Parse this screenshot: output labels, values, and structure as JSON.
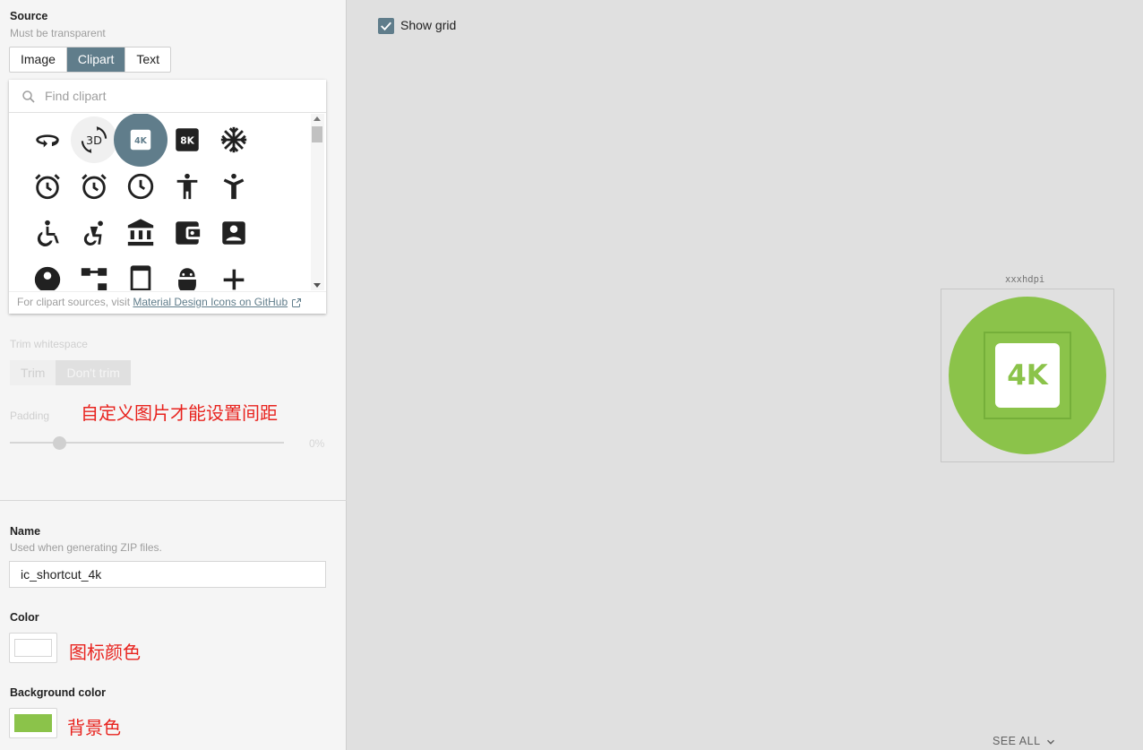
{
  "colors": {
    "accent": "#607d8b",
    "icon_color": "#ffffff",
    "background_color": "#8bc34a",
    "annotation_red": "#e8231e"
  },
  "source": {
    "label": "Source",
    "hint": "Must be transparent",
    "options": [
      "Image",
      "Clipart",
      "Text"
    ],
    "selected": "Clipart"
  },
  "clipart": {
    "search_placeholder": "Find clipart",
    "icons": [
      "360-icon",
      "3d-rotation-icon",
      "4k-icon",
      "8k-icon",
      "ac-unit-icon",
      "access-alarm-icon",
      "access-alarms-icon",
      "access-time-icon",
      "accessibility-icon",
      "accessibility-new-icon",
      "accessible-icon",
      "accessible-forward-icon",
      "account-balance-icon",
      "account-balance-wallet-icon",
      "account-box-icon",
      "account-circle-icon",
      "account-tree-icon",
      "ad-units-icon",
      "adb-icon",
      "add-icon"
    ],
    "selected_icon": "4k-icon",
    "footer_prefix": "For clipart sources, visit",
    "footer_link": "Material Design Icons on GitHub"
  },
  "trim": {
    "label": "Trim whitespace",
    "options": [
      "Trim",
      "Don't trim"
    ],
    "selected": "Don't trim"
  },
  "padding": {
    "label": "Padding",
    "value": "0%",
    "annotation": "自定义图片才能设置间距"
  },
  "name": {
    "label": "Name",
    "hint": "Used when generating ZIP files.",
    "value": "ic_shortcut_4k"
  },
  "color": {
    "label": "Color",
    "annotation": "图标颜色"
  },
  "background": {
    "label": "Background color",
    "annotation": "背景色"
  },
  "preview": {
    "show_grid_label": "Show grid",
    "show_grid_checked": true,
    "density_label": "xxxhdpi",
    "icon_text": "4K",
    "see_all": "SEE ALL"
  }
}
